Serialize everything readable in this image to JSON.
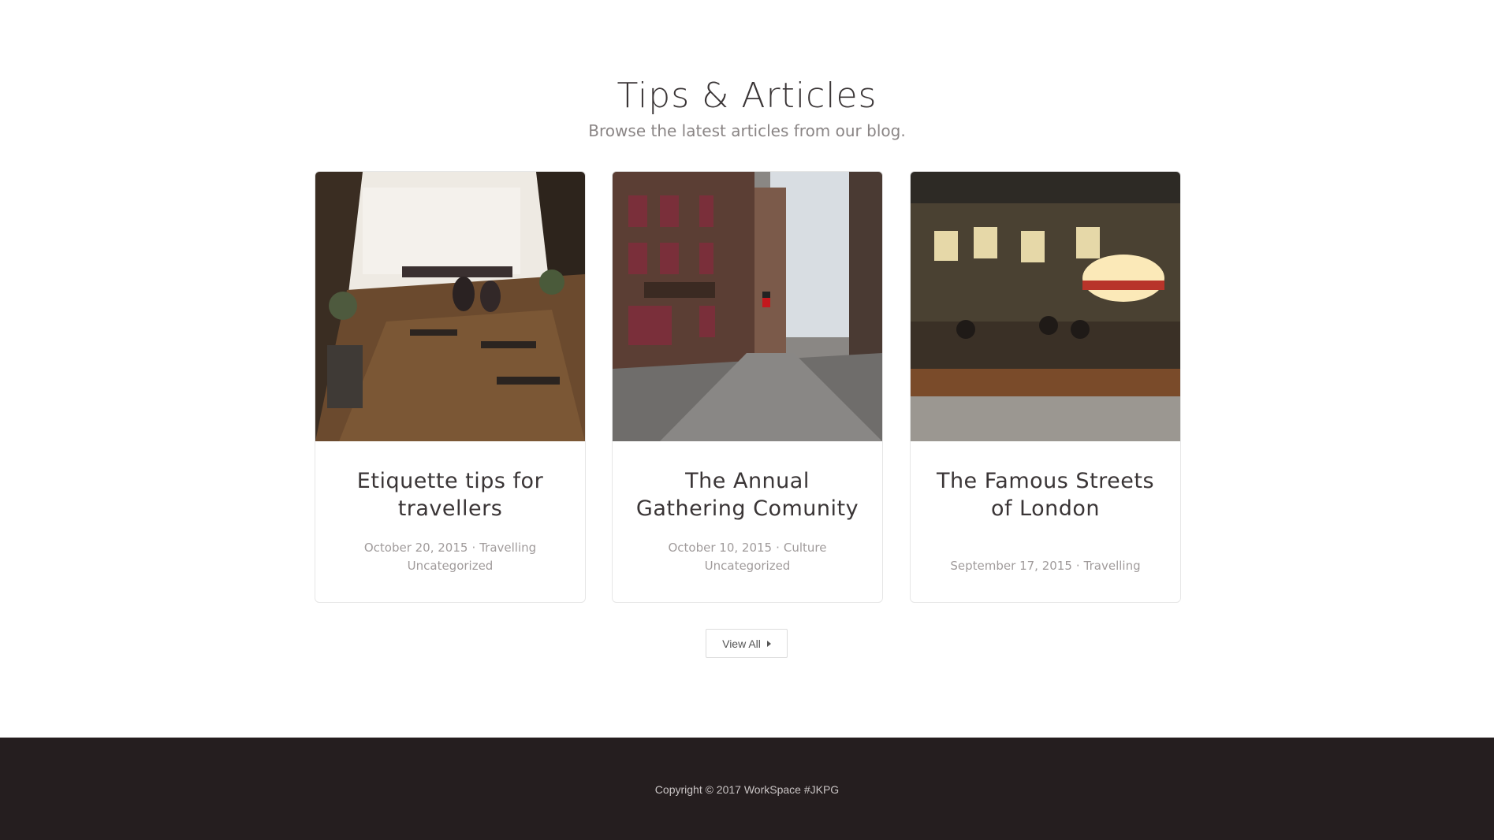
{
  "section": {
    "title": "Tips & Articles",
    "subtitle": "Browse the latest articles from our blog."
  },
  "articles": [
    {
      "title": "Etiquette tips for travellers",
      "date": "October 20, 2015",
      "category": "Travelling",
      "tag": "Uncategorized",
      "image_name": "cafe-interior-photo"
    },
    {
      "title": "The Annual Gathering Comunity",
      "date": "October 10, 2015",
      "category": "Culture",
      "tag": "Uncategorized",
      "image_name": "city-street-photo"
    },
    {
      "title": "The Famous Streets of London",
      "date": "September 17, 2015",
      "category": "Travelling",
      "image_name": "restaurant-bar-photo"
    }
  ],
  "view_all": {
    "label": "View All",
    "icon": "caret-right-icon"
  },
  "footer": {
    "copyright": "Copyright © 2017 WorkSpace #JKPG"
  },
  "colors": {
    "heading": "#3a3536",
    "meta": "#a09b9b",
    "footer_bg": "#251e1f",
    "footer_text": "#c9c4c4"
  }
}
